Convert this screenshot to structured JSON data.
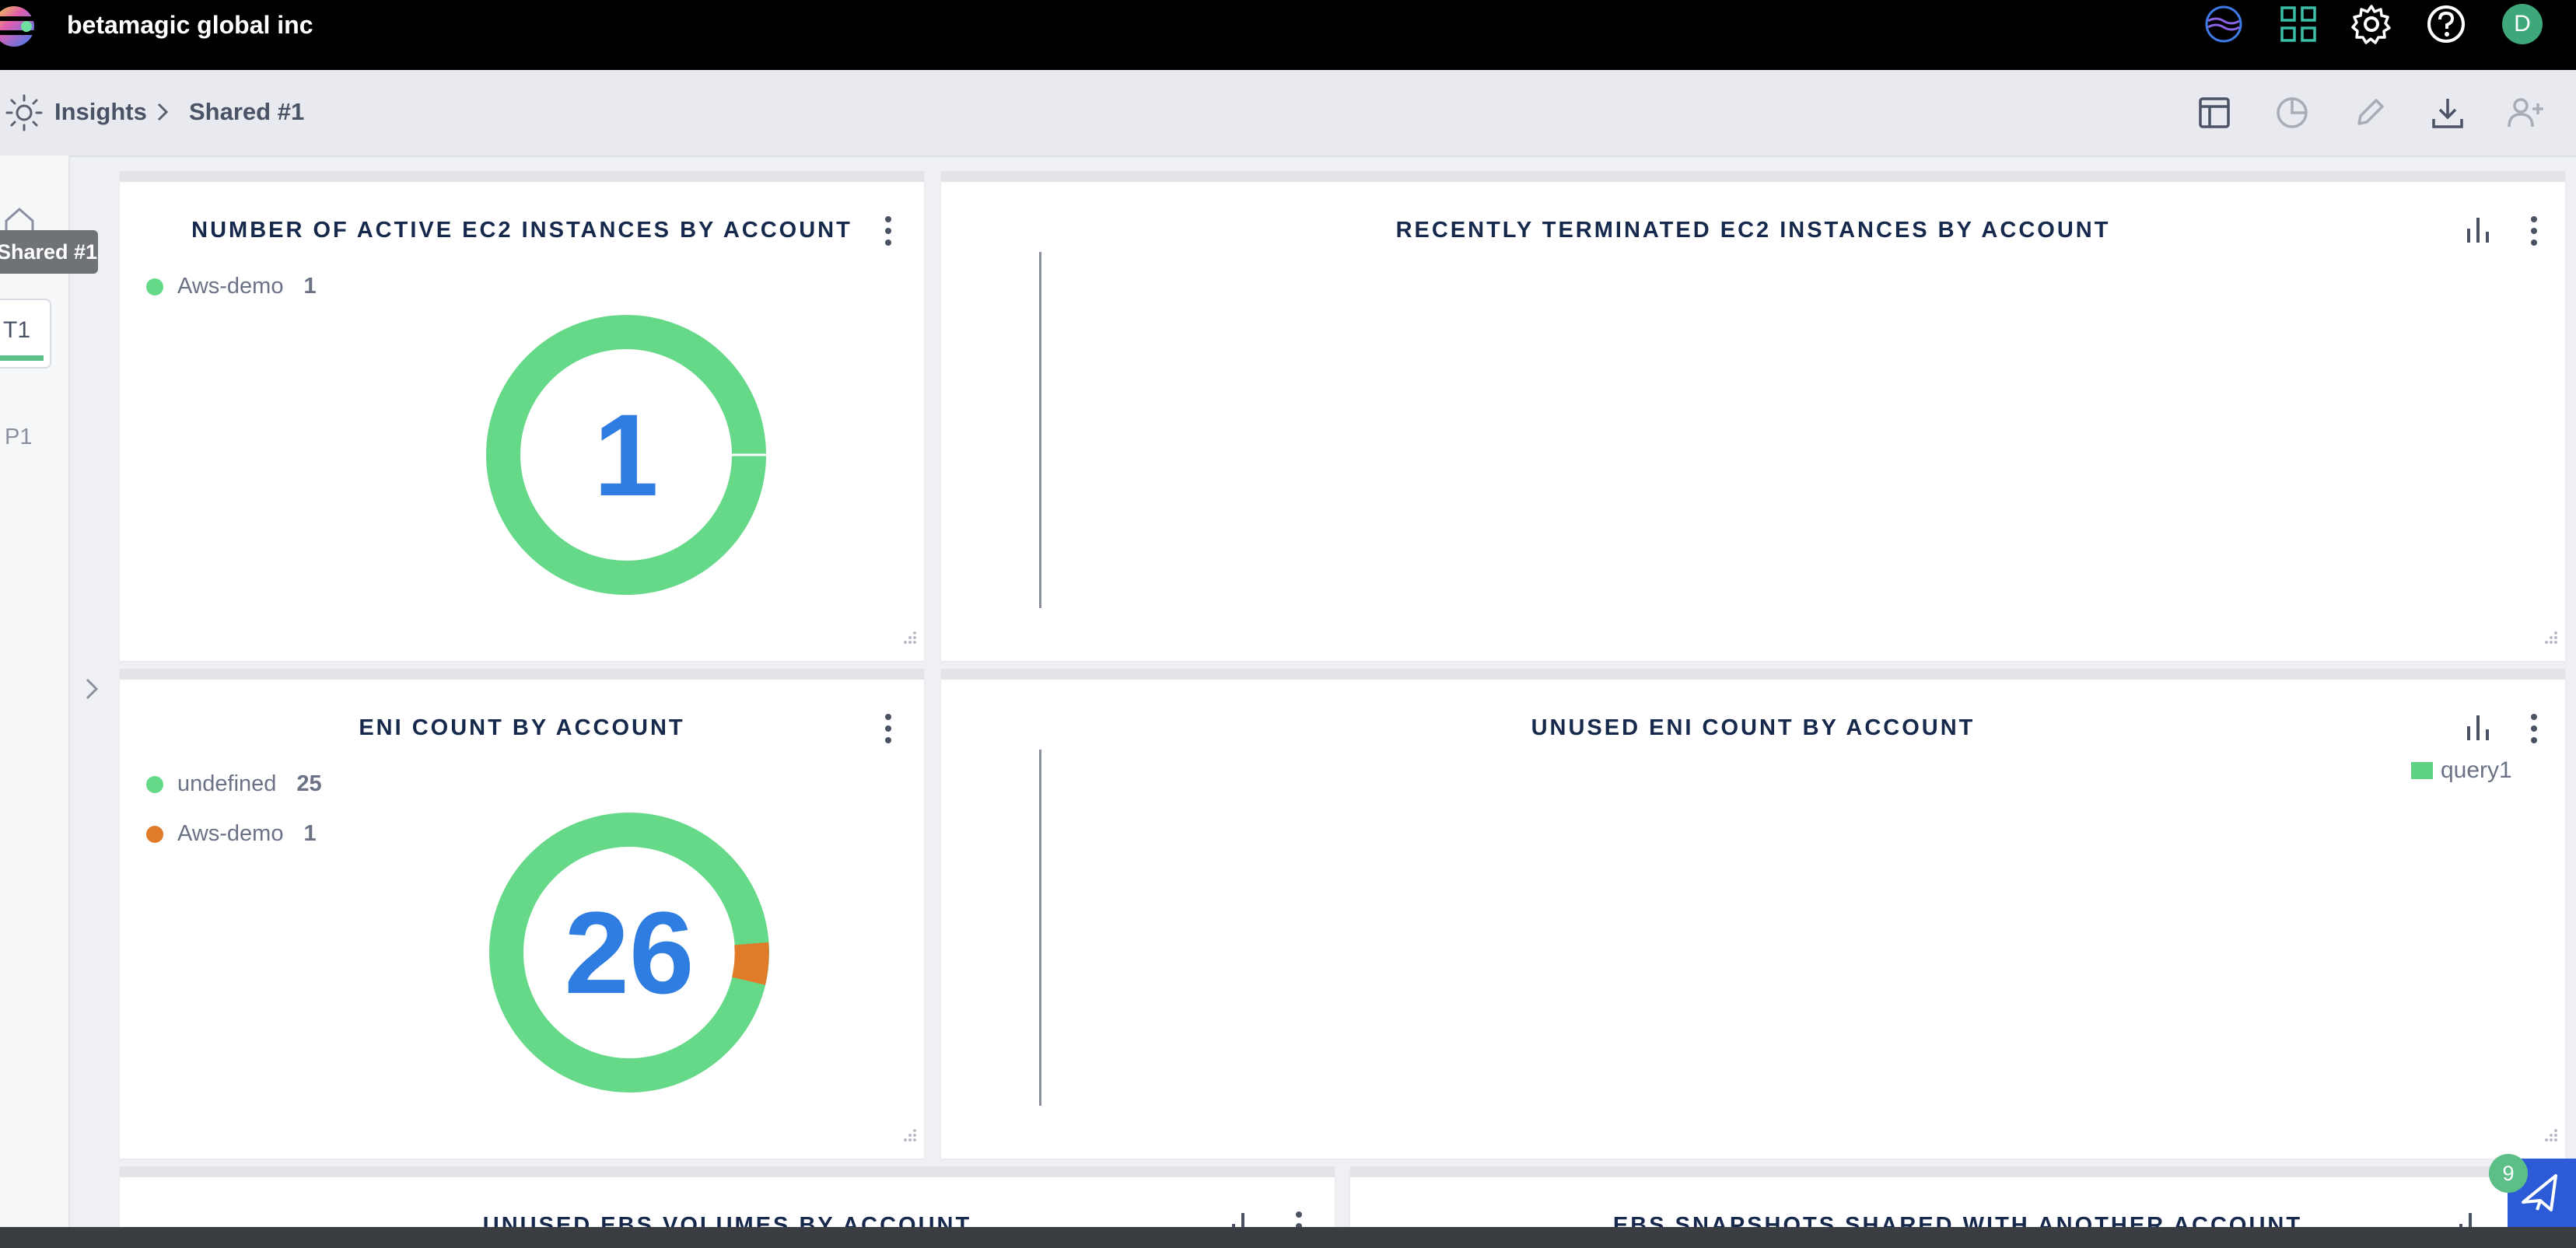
{
  "app": {
    "org_name": "betamagic global inc",
    "avatar_initial": "D"
  },
  "topbar": {
    "icons": [
      "globe-icon",
      "apps-grid-icon",
      "settings-gear-icon",
      "help-icon",
      "user-avatar"
    ]
  },
  "breadcrumb": {
    "root": "Insights",
    "current": "Shared #1"
  },
  "toolbar": {
    "icons": [
      "layout-icon",
      "pie-chart-icon",
      "edit-pencil-icon",
      "download-icon",
      "add-user-icon"
    ]
  },
  "rail": {
    "tooltip": "Shared #1",
    "tabs": [
      {
        "label": "T1",
        "active": true
      },
      {
        "label": "P1",
        "active": false
      }
    ]
  },
  "colors": {
    "green": "#66d988",
    "orange": "#e07b2a",
    "blue_number": "#2f7de0",
    "accent": "#5bbf87"
  },
  "widgets": {
    "active_ec2": {
      "title": "NUMBER OF ACTIVE EC2 INSTANCES BY ACCOUNT",
      "legend": [
        {
          "name": "Aws-demo",
          "value": "1",
          "color": "#66d988"
        }
      ],
      "total": "1"
    },
    "terminated_ec2": {
      "title": "RECENTLY TERMINATED EC2 INSTANCES BY ACCOUNT"
    },
    "eni_count": {
      "title": "ENI COUNT BY ACCOUNT",
      "legend": [
        {
          "name": "undefined",
          "value": "25",
          "color": "#66d988"
        },
        {
          "name": "Aws-demo",
          "value": "1",
          "color": "#e07b2a"
        }
      ],
      "total": "26"
    },
    "unused_eni": {
      "title": "UNUSED ENI COUNT BY ACCOUNT",
      "legend_label": "query1"
    },
    "unused_ebs": {
      "title": "UNUSED EBS VOLUMES BY ACCOUNT"
    },
    "ebs_snapshots": {
      "title": "EBS SNAPSHOTS SHARED WITH ANOTHER ACCOUNT"
    }
  },
  "chat": {
    "badge_count": "9"
  }
}
